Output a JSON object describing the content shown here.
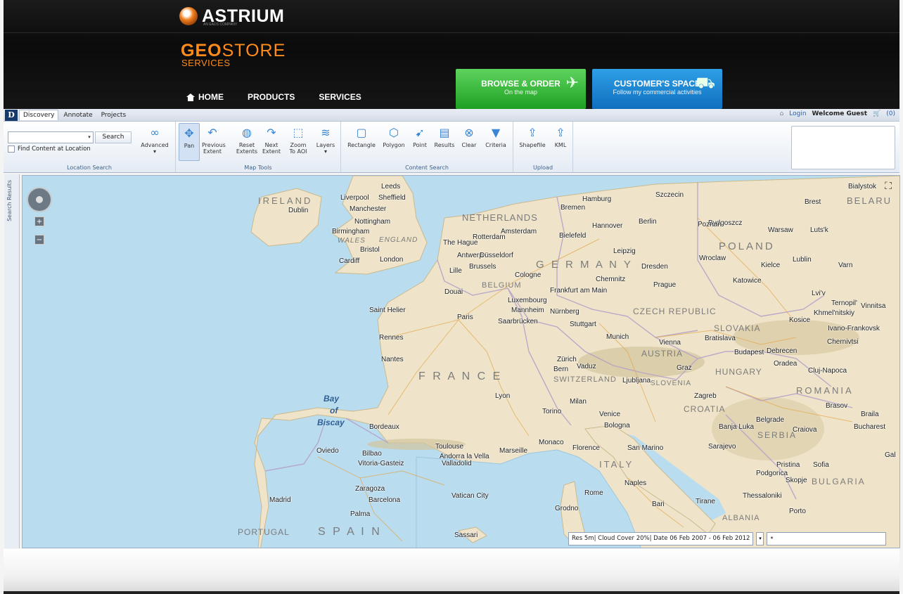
{
  "brand": {
    "company": "ASTRIUM",
    "company_tagline": "AN EADS COMPANY",
    "geo_bold": "GEO",
    "geo_light": "STORE",
    "services": "SERVICES",
    "accent_color": "#ff8c1a"
  },
  "topnav": {
    "home": "HOME",
    "products": "PRODUCTS",
    "services": "SERVICES"
  },
  "cta": {
    "browse_title": "BROWSE & ORDER",
    "browse_sub": "On the map",
    "customer_title": "CUSTOMER'S SPACE",
    "customer_sub": "Follow my commercial activities"
  },
  "appbar": {
    "logo": "D",
    "tabs": [
      "Discovery",
      "Annotate",
      "Projects"
    ],
    "login": "Login",
    "welcome": "Welcome Guest",
    "cart": "(0)"
  },
  "ribbon": {
    "location_search": {
      "label": "Location Search",
      "search_button": "Search",
      "find_content": "Find Content at Location",
      "advanced": "Advanced"
    },
    "map_tools": {
      "label": "Map Tools",
      "tools": [
        {
          "label": "Pan",
          "icon": "pan-icon"
        },
        {
          "label": "Previous Extent",
          "icon": "previous-extent-icon"
        },
        {
          "label": "Reset Extents",
          "icon": "globe-icon"
        },
        {
          "label": "Next Extent",
          "icon": "next-extent-icon"
        },
        {
          "label": "Zoom To AOI",
          "icon": "zoom-aoi-icon"
        },
        {
          "label": "Layers",
          "icon": "layers-icon"
        }
      ]
    },
    "content_search": {
      "label": "Content Search",
      "tools": [
        {
          "label": "Rectangle",
          "icon": "rectangle-icon"
        },
        {
          "label": "Polygon",
          "icon": "polygon-icon"
        },
        {
          "label": "Point",
          "icon": "point-icon"
        },
        {
          "label": "Results",
          "icon": "results-icon"
        },
        {
          "label": "Clear",
          "icon": "clear-icon"
        },
        {
          "label": "Criteria",
          "icon": "criteria-icon"
        }
      ]
    },
    "upload": {
      "label": "Upload",
      "tools": [
        {
          "label": "Shapefile",
          "icon": "shapefile-icon"
        },
        {
          "label": "KML",
          "icon": "kml-icon"
        }
      ]
    }
  },
  "sidebar": {
    "search_results": "Search Results"
  },
  "map": {
    "water_labels": [
      "Bay",
      "of",
      "Biscay"
    ],
    "countries": [
      "IRELAND",
      "NETHERLANDS",
      "BELGIUM",
      "G E R M A N Y",
      "POLAND",
      "CZECH REPUBLIC",
      "SLOVAKIA",
      "AUSTRIA",
      "HUNGARY",
      "F R A N C E",
      "SWITZERLAND",
      "SLOVENIA",
      "CROATIA",
      "ROMANIA",
      "SERBIA",
      "ITALY",
      "BULGARIA",
      "PORTUGAL",
      "S P A I N",
      "ALBANIA",
      "WALES",
      "ENGLAND",
      "BELARU"
    ],
    "cities": [
      "Leeds",
      "Liverpool",
      "Sheffield",
      "Manchester",
      "Dublin",
      "Nottingham",
      "Birmingham",
      "Bristol",
      "Cardiff",
      "London",
      "The Hague",
      "Rotterdam",
      "Amsterdam",
      "Antwerp",
      "Düsseldorf",
      "Brussels",
      "Lille",
      "Cologne",
      "Douai",
      "Luxembourg",
      "Frankfurt am Main",
      "Chemnitz",
      "Dresden",
      "Leipzig",
      "Hamburg",
      "Bremen",
      "Hannover",
      "Bielefeld",
      "Berlin",
      "Szczecin",
      "Bydgoszcz",
      "Poznan",
      "Warsaw",
      "Wroclaw",
      "Prague",
      "Kielce",
      "Katowice",
      "Lublin",
      "Lvi'v",
      "Ternopil'",
      "Khmel'nitskiy",
      "Vinnitsa",
      "Kosice",
      "Ivano-Frankovsk",
      "Chernivtsi",
      "Saint Helier",
      "Paris",
      "Mannheim",
      "Nürnberg",
      "Saarbrücken",
      "Stuttgart",
      "Munich",
      "Vienna",
      "Bratislava",
      "Budapest",
      "Debrecen",
      "Oradea",
      "Cluj-Napoca",
      "Rennes",
      "Nantes",
      "Zürich",
      "Bern",
      "Vaduz",
      "Graz",
      "Ljubljana",
      "Zagreb",
      "Lyon",
      "Milan",
      "Torino",
      "Venice",
      "Bologna",
      "Banja Luka",
      "Belgrade",
      "Craiova",
      "Bucharest",
      "Brasov",
      "Braila",
      "Bordeaux",
      "Monaco",
      "Marseille",
      "Florence",
      "San Marino",
      "Sarajevo",
      "Pristina",
      "Sofia",
      "Podgorica",
      "Skopje",
      "Oviedo",
      "Bilbao",
      "Vitoria-Gasteiz",
      "Toulouse",
      "Andorra la Vella",
      "Valladolid",
      "Zaragoza",
      "Barcelona",
      "Vatican City",
      "Rome",
      "Naples",
      "Bari",
      "Tirane",
      "Thessaloniki",
      "Porto",
      "Madrid",
      "Palma",
      "Sassari",
      "Grodno",
      "Bialystok",
      "Brest",
      "Luts'k",
      "Varn",
      "Gal"
    ]
  },
  "filter": {
    "summary": "Res 5m| Cloud Cover 20%| Date 06 Feb 2007 - 06 Feb 2012",
    "input_value": "*"
  }
}
